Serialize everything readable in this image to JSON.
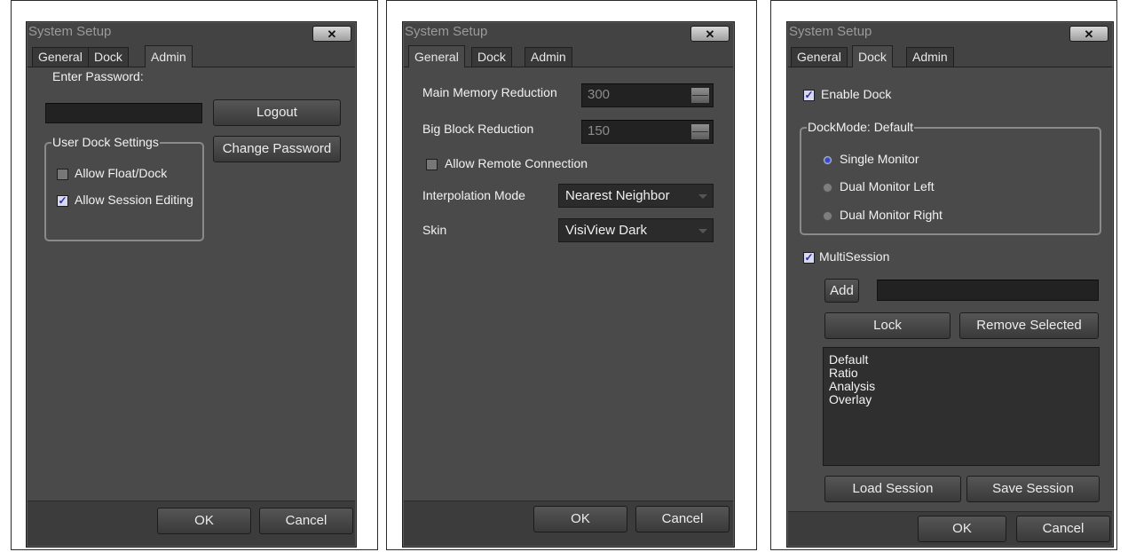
{
  "dialogs": [
    {
      "title": "System Setup",
      "close_glyph": "✕",
      "tabs": [
        "General",
        "Dock",
        "Admin"
      ],
      "active_tab": "Admin",
      "password_label": "Enter Password:",
      "password_value": "",
      "logout_label": "Logout",
      "change_password_label": "Change Password",
      "group_title": "User Dock Settings",
      "allow_float_label": "Allow Float/Dock",
      "allow_float_checked": false,
      "allow_session_label": "Allow Session Editing",
      "allow_session_checked": true,
      "ok_label": "OK",
      "cancel_label": "Cancel"
    },
    {
      "title": "System Setup",
      "close_glyph": "✕",
      "tabs": [
        "General",
        "Dock",
        "Admin"
      ],
      "active_tab": "General",
      "main_memory_label": "Main Memory Reduction",
      "main_memory_value": "300",
      "big_block_label": "Big Block Reduction",
      "big_block_value": "150",
      "remote_label": "Allow Remote Connection",
      "remote_checked": false,
      "interp_label": "Interpolation Mode",
      "interp_value": "Nearest Neighbor",
      "skin_label": "Skin",
      "skin_value": "VisiView Dark",
      "ok_label": "OK",
      "cancel_label": "Cancel"
    },
    {
      "title": "System Setup",
      "close_glyph": "✕",
      "tabs": [
        "General",
        "Dock",
        "Admin"
      ],
      "active_tab": "Dock",
      "enable_dock_label": "Enable Dock",
      "enable_dock_checked": true,
      "dock_mode_title": "DockMode: Default",
      "dock_modes": [
        {
          "label": "Single Monitor",
          "selected": true
        },
        {
          "label": "Dual Monitor Left",
          "selected": false
        },
        {
          "label": "Dual Monitor Right",
          "selected": false
        }
      ],
      "multisession_label": "MultiSession",
      "multisession_checked": true,
      "add_label": "Add",
      "add_value": "",
      "lock_label": "Lock",
      "remove_label": "Remove Selected",
      "sessions": [
        "Default",
        "Ratio",
        "Analysis",
        "Overlay"
      ],
      "load_label": "Load Session",
      "save_label": "Save Session",
      "ok_label": "OK",
      "cancel_label": "Cancel"
    }
  ],
  "colors": {
    "dialog_bg": "#434343",
    "pane_bg": "#4a4a4a",
    "field_bg": "#222222",
    "check_mark": "#2a2ea6"
  }
}
